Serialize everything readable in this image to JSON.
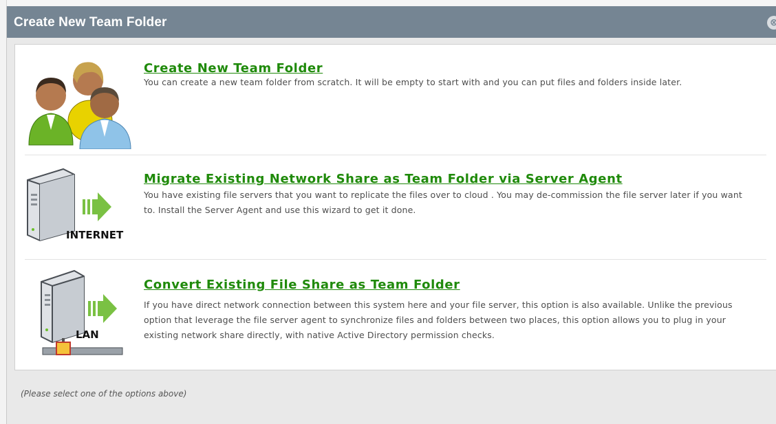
{
  "dialog": {
    "title": "Create New Team Folder",
    "close_glyph": "⊗"
  },
  "options": [
    {
      "title": "Create New Team Folder",
      "description": "You can create a new team folder from scratch. It will be empty to start with and you can put files and folders inside later.",
      "icon": "users-group-icon"
    },
    {
      "title": "Migrate Existing Network Share as Team Folder via Server Agent",
      "description": "You have existing file servers that you want to replicate the files over to cloud . You may de-commission the file server later if you want to. Install the Server Agent and use this wizard to get it done.",
      "icon": "server-internet-icon",
      "icon_label": "INTERNET"
    },
    {
      "title": "Convert Existing File Share as Team Folder",
      "description": "If you have direct network connection between this system here and your file server, this option is also available. Unlike the previous option that leverage the file server agent to synchronize files and folders between two places, this option allows you to plug in your existing network share directly, with native Active Directory permission checks.",
      "icon": "server-lan-icon",
      "icon_label": "LAN"
    }
  ],
  "footer": {
    "hint": "(Please select one of the options above)"
  },
  "colors": {
    "titlebar": "#758593",
    "link_green": "#1f8a0a",
    "arrow_green": "#7ac143"
  }
}
